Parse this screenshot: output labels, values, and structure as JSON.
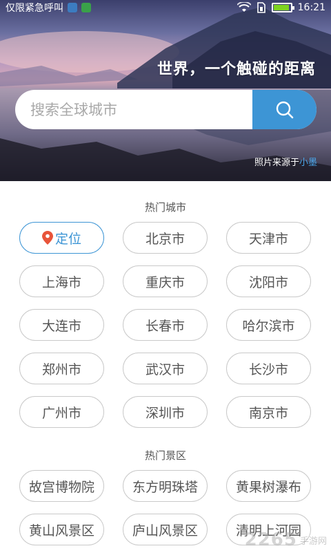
{
  "status_bar": {
    "carrier": "仅限紧急呼叫",
    "time": "16:21"
  },
  "hero": {
    "slogan": "世界，一个触碰的距离",
    "credit_prefix": "照片来源于",
    "credit_author": "小墨"
  },
  "search": {
    "placeholder": "搜索全球城市",
    "button_icon": "search-icon"
  },
  "hot_cities": {
    "title": "热门城市",
    "locate_label": "定位",
    "items": [
      "北京市",
      "天津市",
      "上海市",
      "重庆市",
      "沈阳市",
      "大连市",
      "长春市",
      "哈尔滨市",
      "郑州市",
      "武汉市",
      "长沙市",
      "广州市",
      "深圳市",
      "南京市"
    ]
  },
  "hot_scenic": {
    "title": "热门景区",
    "items": [
      "故宫博物院",
      "东方明珠塔",
      "黄果树瀑布",
      "黄山风景区",
      "庐山风景区",
      "清明上河园"
    ]
  },
  "watermark": {
    "text": "2265",
    "sub": "手游网"
  },
  "colors": {
    "accent": "#3d95d5",
    "locate_pin": "#e8543a",
    "chip_border": "#c9c9c9"
  }
}
